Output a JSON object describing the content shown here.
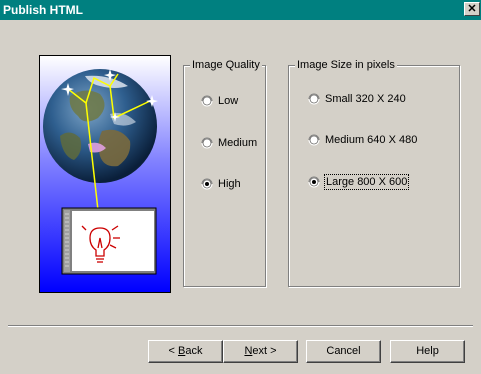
{
  "window": {
    "title": "Publish HTML",
    "close_glyph": "✕"
  },
  "image_quality": {
    "title": "Image Quality",
    "options": [
      {
        "label": "Low",
        "selected": false
      },
      {
        "label": "Medium",
        "selected": false
      },
      {
        "label": "High",
        "selected": true
      }
    ]
  },
  "image_size": {
    "title": "Image Size in pixels",
    "options": [
      {
        "label": "Small 320 X 240",
        "selected": false
      },
      {
        "label": "Medium 640 X 480",
        "selected": false
      },
      {
        "label": "Large 800 X 600",
        "selected": true
      }
    ]
  },
  "buttons": {
    "back": {
      "mnemonic": "B",
      "rest": "ack",
      "prefix": "< "
    },
    "next": {
      "mnemonic": "N",
      "rest": "ext",
      "suffix": " >"
    },
    "cancel": "Cancel",
    "help": "Help"
  },
  "colors": {
    "titlebar": "#008080",
    "face": "#d4d0c8",
    "illustration_top": "#ffffff",
    "illustration_bottom": "#0000ff",
    "link_line": "#ffff00"
  },
  "icons": {
    "globe": "globe-illustration",
    "bulb": "lightbulb-icon",
    "page": "web-page-icon"
  }
}
